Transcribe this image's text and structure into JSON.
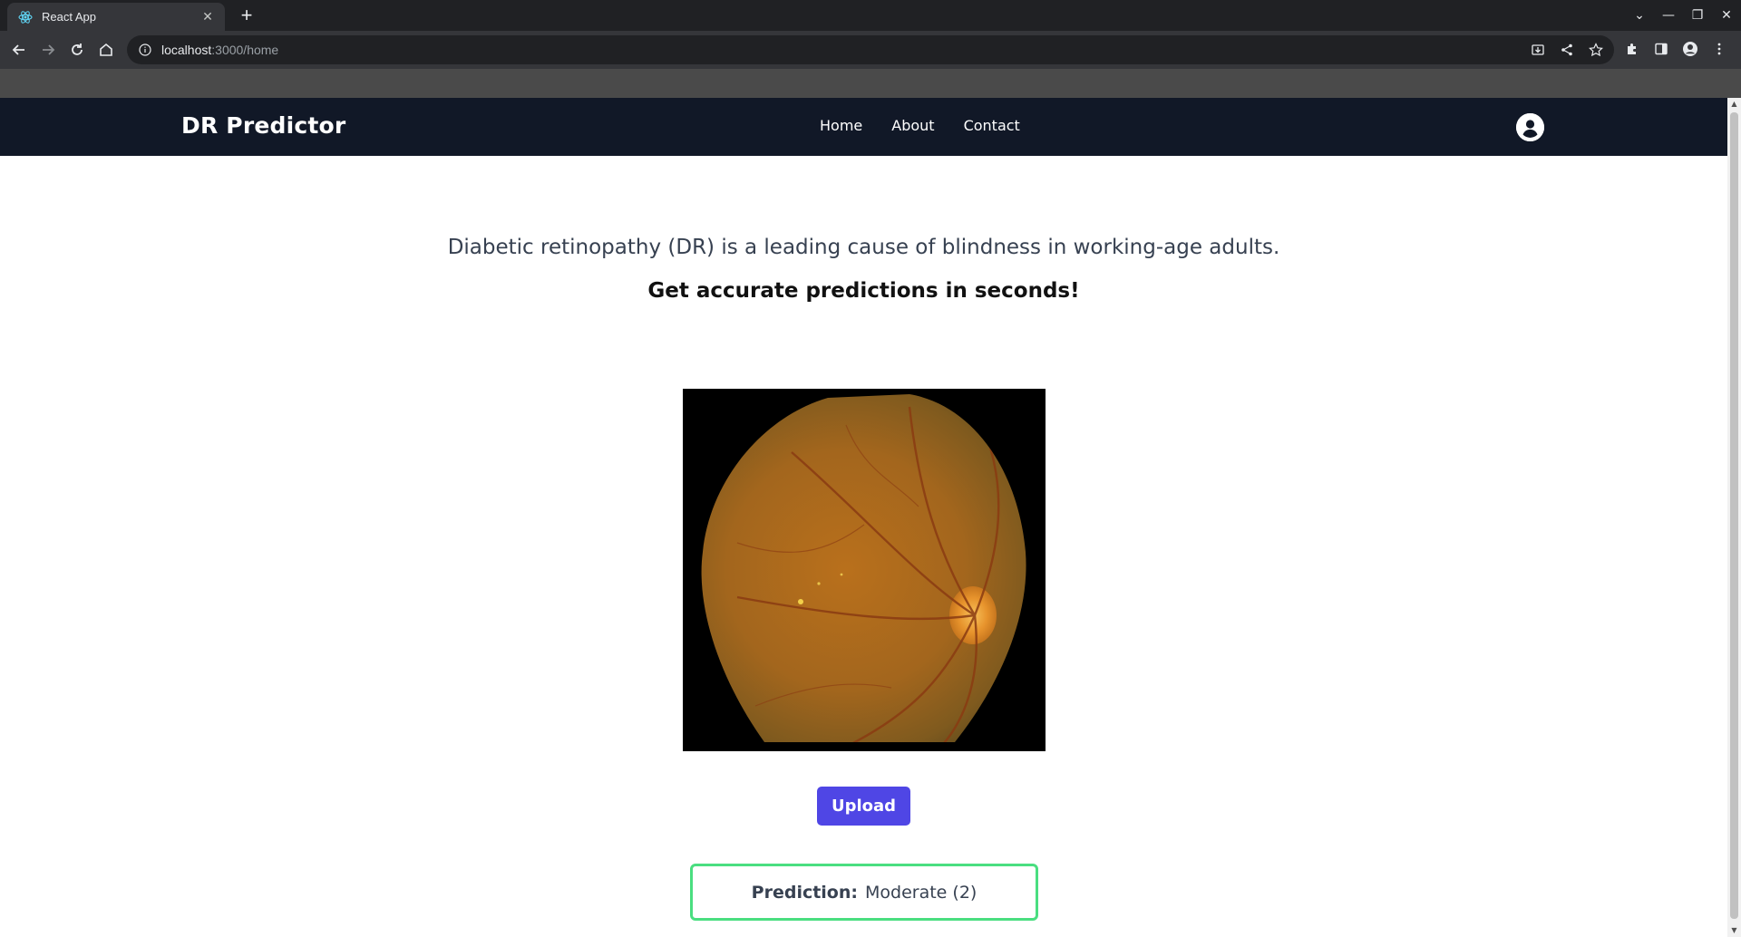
{
  "browser": {
    "tab_title": "React App",
    "tab_close": "✕",
    "new_tab": "+",
    "url_host": "localhost",
    "url_path": ":3000/home",
    "win_controls": [
      "⌄",
      "—",
      "❐",
      "✕"
    ]
  },
  "navbar": {
    "brand": "DR Predictor",
    "links": [
      "Home",
      "About",
      "Contact"
    ]
  },
  "hero": {
    "description": "Diabetic retinopathy (DR) is a leading cause of blindness in working-age adults.",
    "tagline": "Get accurate predictions in seconds!"
  },
  "upload": {
    "button_label": "Upload"
  },
  "result": {
    "label": "Prediction:",
    "value": "Moderate (2)"
  },
  "colors": {
    "navbar_bg": "#111827",
    "upload_btn": "#4f46e5",
    "result_border": "#4ade80"
  }
}
